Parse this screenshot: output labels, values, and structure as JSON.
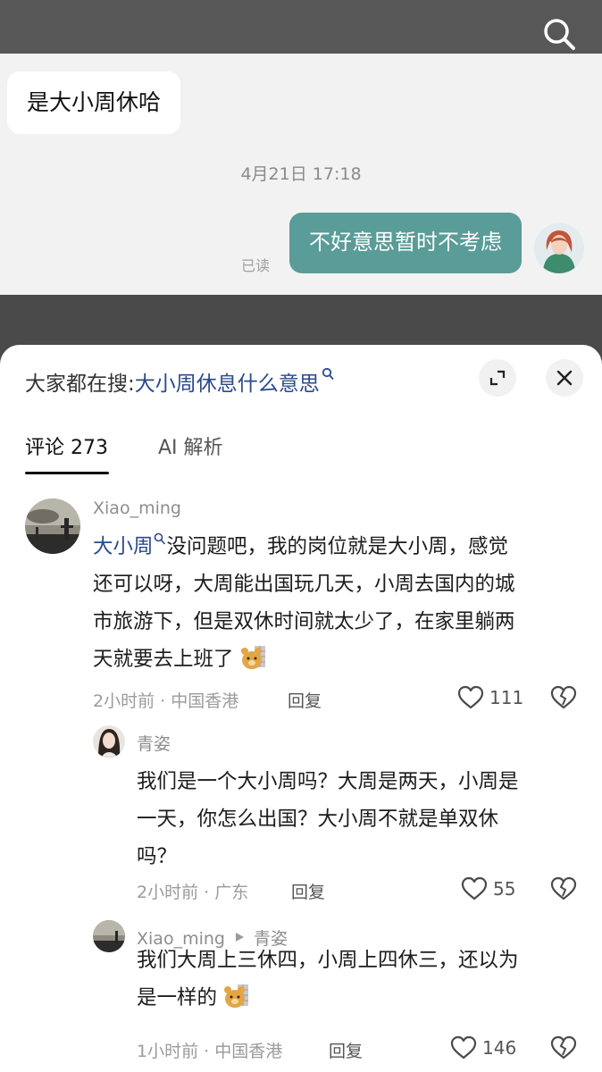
{
  "chat": {
    "incoming_message": "是大小周休哈",
    "timestamp": "4月21日 17:18",
    "outgoing_message": "不好意思暂时不考虑",
    "read_status": "已读"
  },
  "sheet": {
    "search_prefix": "大家都在搜:",
    "search_term": "大小周休息什么意思",
    "tabs": {
      "comments": "评论 273",
      "ai": "AI 解析"
    }
  },
  "comments": [
    {
      "username": "Xiao_ming",
      "link_term": "大小周",
      "text_line1_rest": "没问题吧，我的岗位就是大小周，感觉",
      "text_line2": "还可以呀，大周能出国玩几天，小周去国内的城",
      "text_line3": "市旅游下，但是双休时间就太少了，在家里躺两",
      "text_line4": "天就要去上班了",
      "meta": "2小时前 · 中国香港",
      "reply_label": "回复",
      "likes": "111"
    },
    {
      "username": "青姿",
      "text_line1": "我们是一个大小周吗？大周是两天，小周是",
      "text_line2": "一天，你怎么出国？大小周不就是单双休",
      "text_line3": "吗？",
      "meta": "2小时前 · 广东",
      "reply_label": "回复",
      "likes": "55"
    },
    {
      "username": "Xiao_ming",
      "reply_to": "青姿",
      "text_line1": "我们大周上三休四，小周上四休三，还以为",
      "text_line2": "是一样的",
      "meta": "1小时前 · 中国香港",
      "reply_label": "回复",
      "likes": "146"
    }
  ],
  "colors": {
    "link": "#2a4a8c",
    "outgoing_bubble": "#5a9c98",
    "overlay": "#575757"
  },
  "icons": [
    "search-icon",
    "expand-icon",
    "close-icon",
    "heart-icon",
    "broken-heart-icon",
    "reply-arrow-icon",
    "bear-emoji"
  ]
}
